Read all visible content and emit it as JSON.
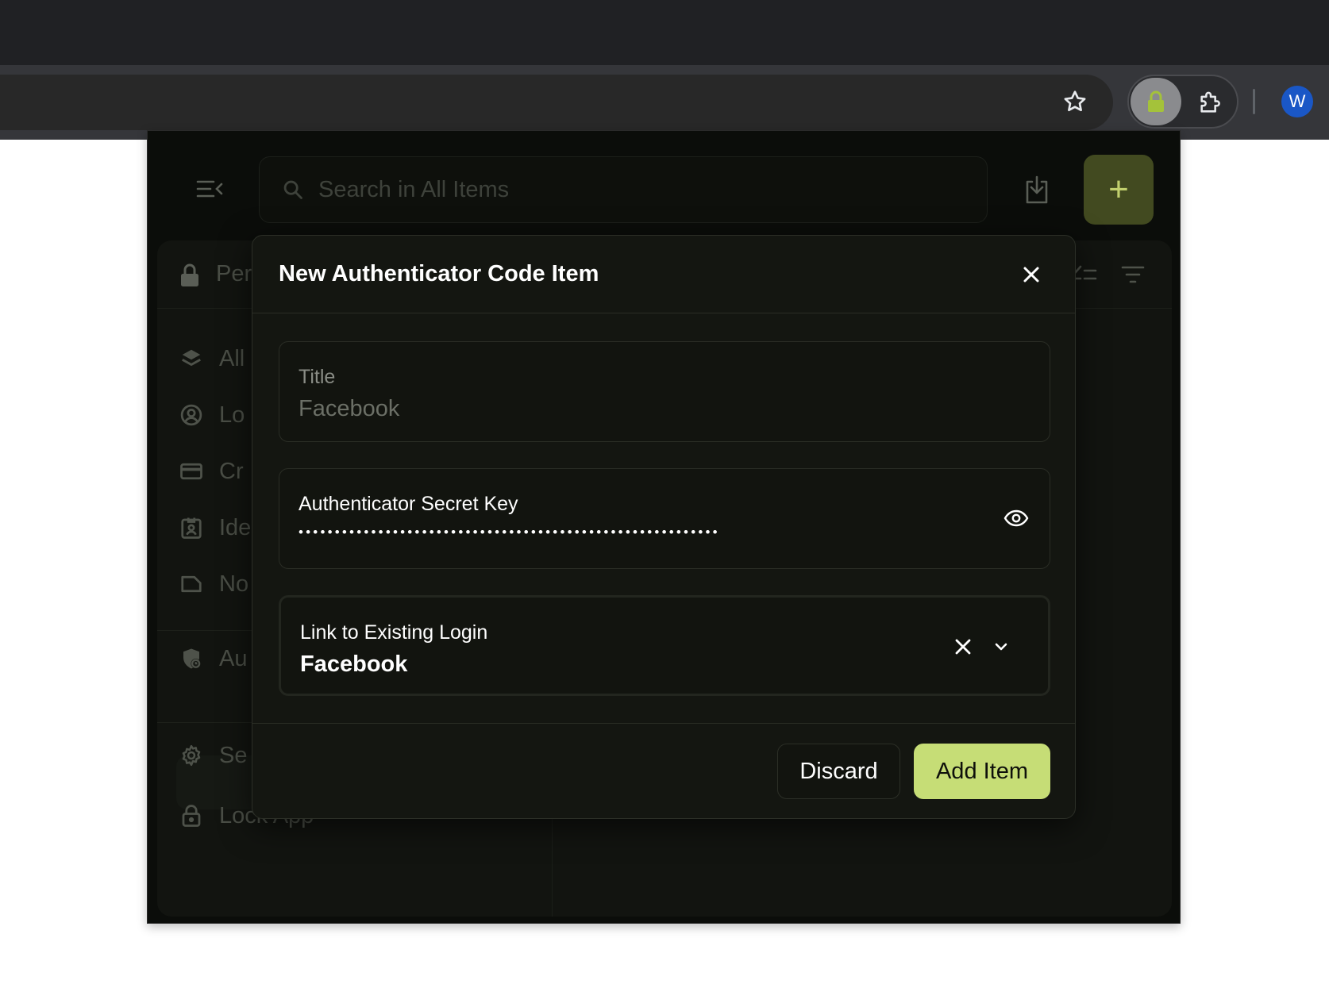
{
  "browser": {
    "profile_initial": "W"
  },
  "app": {
    "search": {
      "placeholder": "Search in All Items"
    },
    "add_button_label": "+",
    "vault": {
      "name": "Per"
    },
    "sidebar": {
      "items": [
        {
          "label": "All",
          "icon": "layers-icon"
        },
        {
          "label": "Lo",
          "icon": "user-circle-icon"
        },
        {
          "label": "Cr",
          "icon": "credit-card-icon"
        },
        {
          "label": "Ide",
          "icon": "id-badge-icon"
        },
        {
          "label": "No",
          "icon": "note-icon"
        },
        {
          "label": "Au",
          "icon": "shield-clock-icon"
        },
        {
          "label": "Se",
          "icon": "gear-icon"
        },
        {
          "label": "Lock App",
          "icon": "lock-icon"
        }
      ]
    }
  },
  "modal": {
    "title": "New Authenticator Code Item",
    "title_field": {
      "label": "Title",
      "value": "Facebook"
    },
    "secret_field": {
      "label": "Authenticator Secret Key",
      "masked_value": "••••••••••••••••••••••••••••••••••••••••••••••••••••••••••"
    },
    "link_field": {
      "label": "Link to Existing Login",
      "value": "Facebook"
    },
    "discard_label": "Discard",
    "add_label": "Add Item"
  },
  "colors": {
    "accent": "#c6dd76",
    "add_button_bg": "#424a20",
    "background": "#0b0d0a",
    "profile_avatar": "#1a57c6"
  }
}
